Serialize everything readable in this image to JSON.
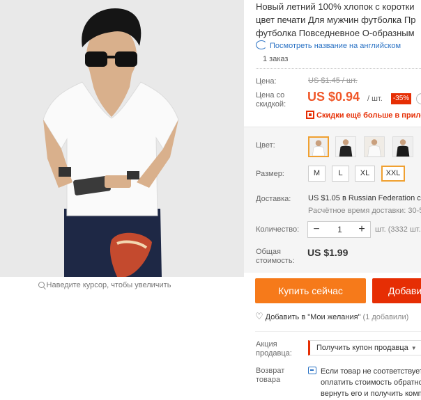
{
  "product": {
    "title_lines": [
      "Новый летний 100% хлопок с коротки",
      "цвет печати Для мужчин футболка Пр",
      "футболка Повседневное О-образным"
    ],
    "translate_link": "Посмотреть название на английском",
    "orders": "1 заказ"
  },
  "gallery": {
    "zoom_hint": "Наведите курсор, чтобы увеличить"
  },
  "pricing": {
    "price_label": "Цена:",
    "old_price": "US $1.45 / шт.",
    "discount_label_line1": "Цена со",
    "discount_label_line2": "скидкой:",
    "price": "US $0.94",
    "per_unit": "/ шт.",
    "discount_badge": "-35%",
    "promo_text": "Скидки ещё больше в прило"
  },
  "options": {
    "color_label": "Цвет:",
    "size_label": "Размер:",
    "sizes": [
      "M",
      "L",
      "XL",
      "XXL"
    ],
    "selected_size": "XXL"
  },
  "shipping": {
    "label": "Доставка:",
    "price": "US $1.05",
    "destination": "в Russian Federation с",
    "time": "Расчётное время доставки: 30-5"
  },
  "quantity": {
    "label": "Количество:",
    "value": "1",
    "minus": "−",
    "plus": "+",
    "available": "шт. (3332 шт. д"
  },
  "total": {
    "label_line1": "Общая",
    "label_line2": "стоимость:",
    "value": "US $1.99"
  },
  "actions": {
    "buy_now": "Купить сейчас",
    "add_to_cart": "Добавит",
    "wishlist": "Добавить в \"Мои желания\"",
    "wishlist_count": "(1 добавили)"
  },
  "seller": {
    "promo_label_line1": "Акция",
    "promo_label_line2": "продавца:",
    "coupon_button": "Получить купон продавца",
    "return_label_line1": "Возврат",
    "return_label_line2": "товара",
    "return_text_line1": "Если товар не соответствует",
    "return_text_line2": "оплатить стоимость обратно",
    "return_text_line3": "вернуть его и получить компенсац"
  },
  "colors": {
    "accent_orange": "#f67a1a",
    "price_red": "#f0582a",
    "badge_red": "#e62e04",
    "link_blue": "#2a72c4",
    "selected_border": "#f0a030"
  }
}
